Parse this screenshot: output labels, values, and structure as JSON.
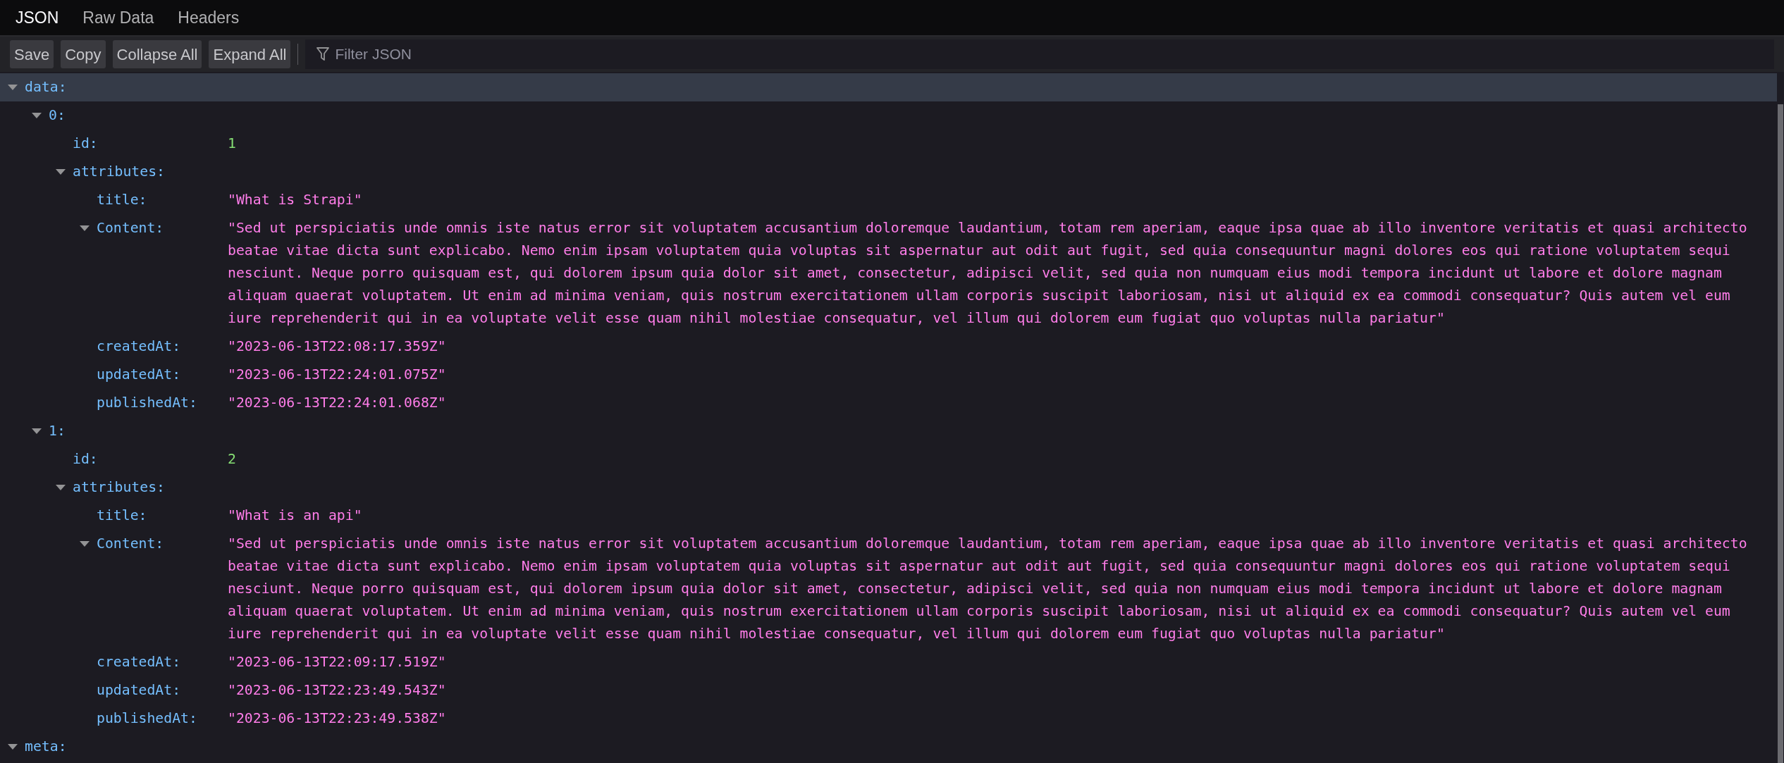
{
  "tabs": [
    {
      "label": "JSON",
      "selected": true
    },
    {
      "label": "Raw Data",
      "selected": false
    },
    {
      "label": "Headers",
      "selected": false
    }
  ],
  "toolbar": {
    "buttons": [
      "Save",
      "Copy",
      "Collapse All",
      "Expand All"
    ],
    "filter": {
      "placeholder": "Filter JSON"
    }
  },
  "tree": [
    {
      "key": "data:",
      "expanded": true,
      "selected": true,
      "children": [
        {
          "key": "0:",
          "expanded": true,
          "selected": false,
          "children": [
            {
              "key": "id:",
              "kind": "number",
              "value": "1",
              "selected": false
            },
            {
              "key": "attributes:",
              "expanded": true,
              "selected": false,
              "children": [
                {
                  "key": "title:",
                  "kind": "string",
                  "value": "\"What is Strapi\"",
                  "selected": false
                },
                {
                  "key": "Content:",
                  "kind": "string",
                  "expanded": true,
                  "value": "\"Sed ut perspiciatis unde omnis iste natus error sit voluptatem accusantium doloremque laudantium, totam rem aperiam, eaque ipsa quae ab illo inventore veritatis et quasi architecto beatae vitae dicta sunt explicabo. Nemo enim ipsam voluptatem quia voluptas sit aspernatur aut odit aut fugit, sed quia consequuntur magni dolores eos qui ratione voluptatem sequi nesciunt. Neque porro quisquam est, qui dolorem ipsum quia dolor sit amet, consectetur, adipisci velit, sed quia non numquam eius modi tempora incidunt ut labore et dolore magnam aliquam quaerat voluptatem. Ut enim ad minima veniam, quis nostrum exercitationem ullam corporis suscipit laboriosam, nisi ut aliquid ex ea commodi consequatur? Quis autem vel eum iure reprehenderit qui in ea voluptate velit esse quam nihil molestiae consequatur, vel illum qui dolorem eum fugiat quo voluptas nulla pariatur\"",
                  "selected": false
                },
                {
                  "key": "createdAt:",
                  "kind": "string",
                  "value": "\"2023-06-13T22:08:17.359Z\"",
                  "selected": false
                },
                {
                  "key": "updatedAt:",
                  "kind": "string",
                  "value": "\"2023-06-13T22:24:01.075Z\"",
                  "selected": false
                },
                {
                  "key": "publishedAt:",
                  "kind": "string",
                  "value": "\"2023-06-13T22:24:01.068Z\"",
                  "selected": false
                }
              ]
            }
          ]
        },
        {
          "key": "1:",
          "expanded": true,
          "selected": false,
          "children": [
            {
              "key": "id:",
              "kind": "number",
              "value": "2",
              "selected": false
            },
            {
              "key": "attributes:",
              "expanded": true,
              "selected": false,
              "children": [
                {
                  "key": "title:",
                  "kind": "string",
                  "value": "\"What is an api\"",
                  "selected": false
                },
                {
                  "key": "Content:",
                  "kind": "string",
                  "expanded": true,
                  "value": "\"Sed ut perspiciatis unde omnis iste natus error sit voluptatem accusantium doloremque laudantium, totam rem aperiam, eaque ipsa quae ab illo inventore veritatis et quasi architecto beatae vitae dicta sunt explicabo. Nemo enim ipsam voluptatem quia voluptas sit aspernatur aut odit aut fugit, sed quia consequuntur magni dolores eos qui ratione voluptatem sequi nesciunt. Neque porro quisquam est, qui dolorem ipsum quia dolor sit amet, consectetur, adipisci velit, sed quia non numquam eius modi tempora incidunt ut labore et dolore magnam aliquam quaerat voluptatem. Ut enim ad minima veniam, quis nostrum exercitationem ullam corporis suscipit laboriosam, nisi ut aliquid ex ea commodi consequatur? Quis autem vel eum iure reprehenderit qui in ea voluptate velit esse quam nihil molestiae consequatur, vel illum qui dolorem eum fugiat quo voluptas nulla pariatur\"",
                  "selected": false
                },
                {
                  "key": "createdAt:",
                  "kind": "string",
                  "value": "\"2023-06-13T22:09:17.519Z\"",
                  "selected": false
                },
                {
                  "key": "updatedAt:",
                  "kind": "string",
                  "value": "\"2023-06-13T22:23:49.543Z\"",
                  "selected": false
                },
                {
                  "key": "publishedAt:",
                  "kind": "string",
                  "value": "\"2023-06-13T22:23:49.538Z\"",
                  "selected": false
                }
              ]
            }
          ]
        }
      ]
    },
    {
      "key": "meta:",
      "expanded": true,
      "selected": false
    }
  ]
}
